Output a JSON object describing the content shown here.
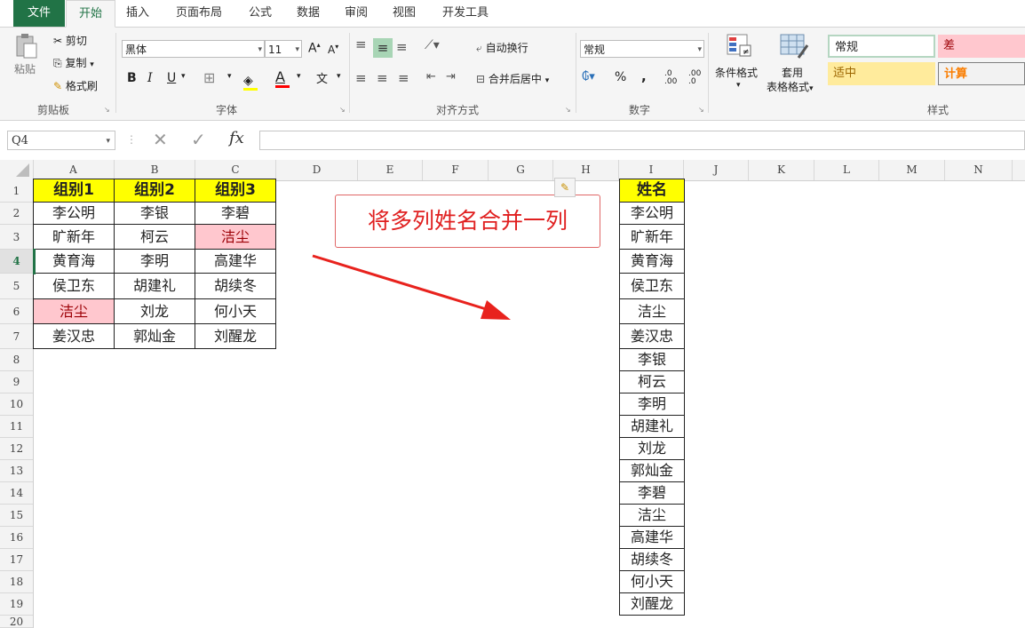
{
  "tabs": [
    "文件",
    "开始",
    "插入",
    "页面布局",
    "公式",
    "数据",
    "审阅",
    "视图",
    "开发工具"
  ],
  "clipboard": {
    "paste": "粘贴",
    "cut": "剪切",
    "copy": "复制",
    "painter": "格式刷",
    "label": "剪贴板"
  },
  "font": {
    "name": "黑体",
    "size": "11",
    "label": "字体",
    "bold": "B",
    "italic": "I",
    "underline": "U",
    "grow": "A",
    "shrink": "A",
    "color_a": "A"
  },
  "align": {
    "wrap": "自动换行",
    "merge": "合并后居中",
    "label": "对齐方式"
  },
  "number": {
    "format": "常规",
    "percent": "%",
    "comma": ",",
    "label": "数字"
  },
  "styles": {
    "cond": "条件格式",
    "table1": "套用",
    "table2": "表格格式",
    "normal": "常规",
    "bad": "差",
    "neutral": "适中",
    "calc": "计算",
    "label": "样式"
  },
  "formula_bar": {
    "name_box": "Q4",
    "fx": "fx"
  },
  "columns": [
    "A",
    "B",
    "C",
    "D",
    "E",
    "F",
    "G",
    "H",
    "I",
    "J",
    "K",
    "L",
    "M",
    "N"
  ],
  "rows": [
    "1",
    "2",
    "3",
    "4",
    "5",
    "6",
    "7",
    "8",
    "9",
    "10",
    "11",
    "12",
    "13",
    "14",
    "15",
    "16",
    "17",
    "18",
    "19",
    "20"
  ],
  "table_headers": [
    "组别1",
    "组别2",
    "组别3"
  ],
  "table_rows": [
    [
      "李公明",
      "李银",
      "李碧"
    ],
    [
      "旷新年",
      "柯云",
      "洁尘"
    ],
    [
      "黄育海",
      "李明",
      "高建华"
    ],
    [
      "侯卫东",
      "胡建礼",
      "胡续冬"
    ],
    [
      "洁尘",
      "刘龙",
      "何小天"
    ],
    [
      "姜汉忠",
      "郭灿金",
      "刘醒龙"
    ]
  ],
  "name_header": "姓名",
  "name_list": [
    "李公明",
    "旷新年",
    "黄育海",
    "侯卫东",
    "洁尘",
    "姜汉忠",
    "李银",
    "柯云",
    "李明",
    "胡建礼",
    "刘龙",
    "郭灿金",
    "李碧",
    "洁尘",
    "高建华",
    "胡续冬",
    "何小天",
    "刘醒龙"
  ],
  "callout": "将多列姓名合并一列",
  "colors": {
    "accent": "#217346",
    "header_yellow": "#ffff00",
    "dup_pink": "#ffc7ce",
    "arrow_red": "#e8221d"
  }
}
